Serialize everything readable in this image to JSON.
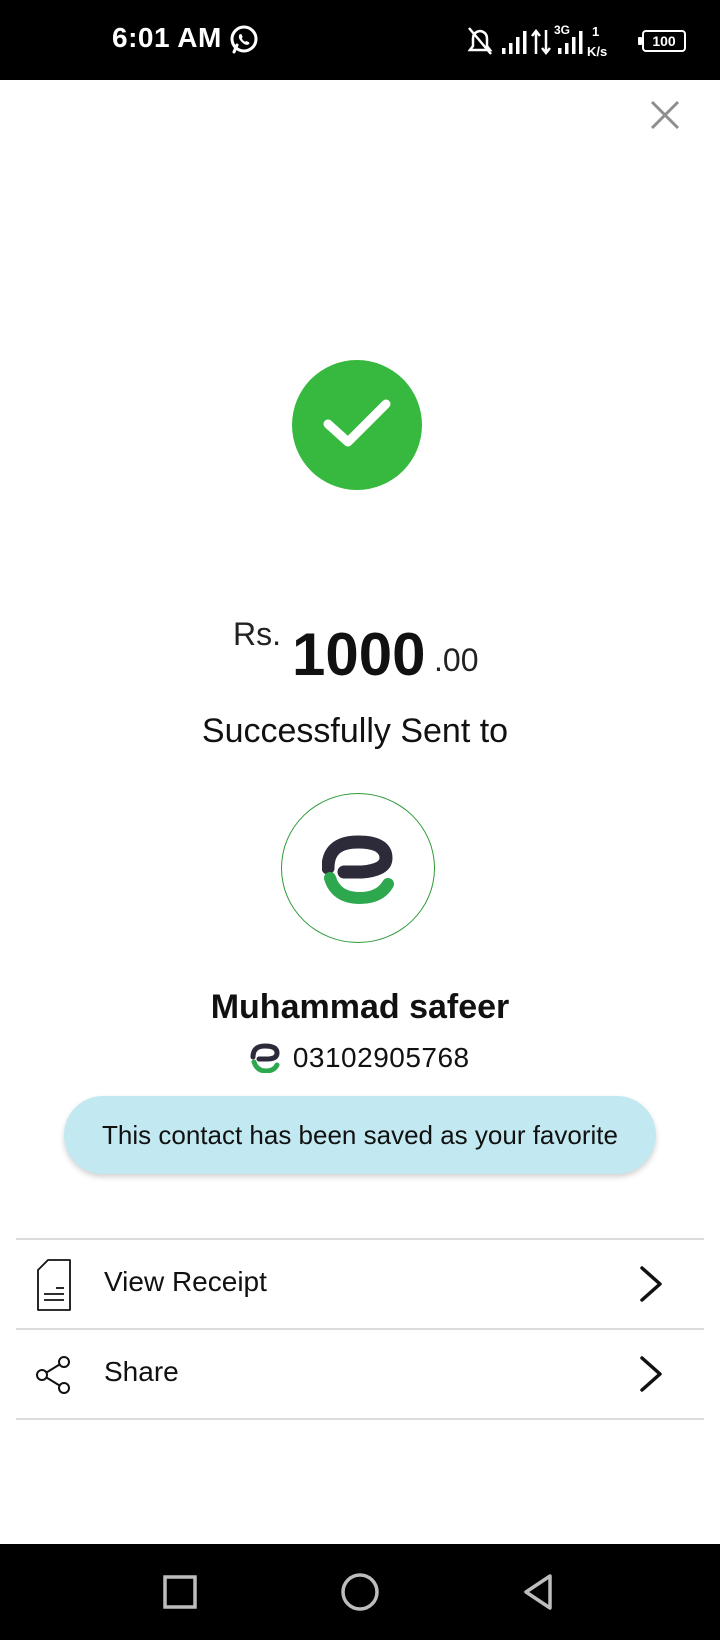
{
  "status_bar": {
    "time": "6:01 AM",
    "network_type": "3G",
    "speed_value": "1",
    "speed_unit": "K/s",
    "battery": "100",
    "icons": [
      "whatsapp-icon",
      "bell-off-icon",
      "signal-icon",
      "data-transfer-icon",
      "signal-3g-icon",
      "battery-icon"
    ]
  },
  "header": {
    "close_icon": "close-icon"
  },
  "colors": {
    "success_green": "#37b93f",
    "pill_background": "#c2e9f1",
    "logo_dark": "#2d2a3a",
    "logo_green": "#2ea84f"
  },
  "transaction": {
    "currency": "Rs.",
    "amount_whole": "1000",
    "amount_decimal": ".00",
    "status_text": "Successfully Sent to"
  },
  "recipient": {
    "name": "Muhammad safeer",
    "number": "03102905768"
  },
  "favorite_message": "This contact has been saved as your favorite",
  "actions": [
    {
      "label": "View Receipt",
      "icon": "receipt-icon"
    },
    {
      "label": "Share",
      "icon": "share-icon"
    }
  ],
  "nav": [
    "recents-square-icon",
    "home-circle-icon",
    "back-triangle-icon"
  ]
}
